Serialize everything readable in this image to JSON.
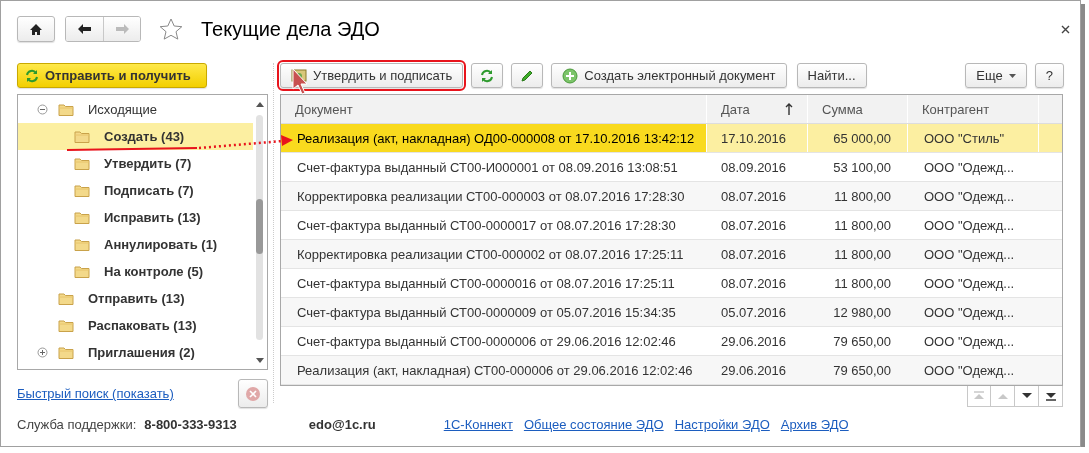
{
  "window": {
    "title": "Текущие дела ЭДО",
    "favorite": false
  },
  "nav": {
    "back_disabled": false,
    "forward_disabled": true
  },
  "left_panel": {
    "send_button": "Отправить и получить",
    "tree": [
      {
        "label": "Исходящие",
        "bold": false,
        "selected": false,
        "expanded": true,
        "children": [
          {
            "label": "Создать (43)",
            "bold": true,
            "selected": true
          },
          {
            "label": "Утвердить (7)",
            "bold": true,
            "selected": false
          },
          {
            "label": "Подписать (7)",
            "bold": true,
            "selected": false
          },
          {
            "label": "Исправить (13)",
            "bold": true,
            "selected": false
          },
          {
            "label": "Аннулировать (1)",
            "bold": true,
            "selected": false
          },
          {
            "label": "На контроле (5)",
            "bold": true,
            "selected": false
          }
        ]
      },
      {
        "label": "Отправить (13)",
        "bold": true,
        "selected": false
      },
      {
        "label": "Распаковать (13)",
        "bold": true,
        "selected": false
      },
      {
        "label": "Приглашения (2)",
        "bold": true,
        "selected": false,
        "expanded": false
      }
    ],
    "quick_search_link": "Быстрый поиск (показать)"
  },
  "toolbar": {
    "buttons": [
      {
        "kind": "approve",
        "label": "Утвердить и подписать",
        "highlighted": true
      },
      {
        "kind": "refresh"
      },
      {
        "kind": "edit"
      },
      {
        "kind": "create",
        "label": "Создать электронный документ"
      },
      {
        "kind": "text",
        "label": "Найти..."
      },
      {
        "kind": "menu",
        "label": "Еще"
      },
      {
        "kind": "text",
        "label": "?"
      }
    ]
  },
  "table": {
    "columns": [
      {
        "label": "Документ"
      },
      {
        "label": "Дата",
        "sort_ascending": true
      },
      {
        "label": "Сумма"
      },
      {
        "label": "Контрагент"
      }
    ],
    "rows": [
      {
        "document": "Реализация (акт, накладная) ОД00-000008 от 17.10.2016 13:42:12",
        "date": "17.10.2016",
        "sum": "65 000,00",
        "counterparty": "ООО \"Стиль\"",
        "selected": true
      },
      {
        "document": "Счет-фактура выданный СТ00-И000001 от 08.09.2016 13:08:51",
        "date": "08.09.2016",
        "sum": "53 100,00",
        "counterparty": "ООО \"Одежд...",
        "selected": false
      },
      {
        "document": "Корректировка реализации СТ00-000003 от 08.07.2016 17:28:30",
        "date": "08.07.2016",
        "sum": "11 800,00",
        "counterparty": "ООО \"Одежд...",
        "selected": false
      },
      {
        "document": "Счет-фактура выданный СТ00-0000017 от 08.07.2016 17:28:30",
        "date": "08.07.2016",
        "sum": "11 800,00",
        "counterparty": "ООО \"Одежд...",
        "selected": false
      },
      {
        "document": "Корректировка реализации СТ00-000002 от 08.07.2016 17:25:11",
        "date": "08.07.2016",
        "sum": "11 800,00",
        "counterparty": "ООО \"Одежд...",
        "selected": false
      },
      {
        "document": "Счет-фактура выданный СТ00-0000016 от 08.07.2016 17:25:11",
        "date": "08.07.2016",
        "sum": "11 800,00",
        "counterparty": "ООО \"Одежд...",
        "selected": false
      },
      {
        "document": "Счет-фактура выданный СТ00-0000009 от 05.07.2016 15:34:35",
        "date": "05.07.2016",
        "sum": "12 980,00",
        "counterparty": "ООО \"Одежд...",
        "selected": false
      },
      {
        "document": "Счет-фактура выданный СТ00-0000006 от 29.06.2016 12:02:46",
        "date": "29.06.2016",
        "sum": "79 650,00",
        "counterparty": "ООО \"Одежд...",
        "selected": false
      },
      {
        "document": "Реализация (акт, накладная) СТ00-000006 от 29.06.2016 12:02:46",
        "date": "29.06.2016",
        "sum": "79 650,00",
        "counterparty": "ООО \"Одежд...",
        "selected": false
      }
    ],
    "nav_buttons": [
      {
        "kind": "first",
        "disabled": true
      },
      {
        "kind": "up",
        "disabled": true
      },
      {
        "kind": "down",
        "disabled": false
      },
      {
        "kind": "last",
        "disabled": false
      }
    ]
  },
  "footer": {
    "support_label": "Служба поддержки:",
    "phone": "8-800-333-9313",
    "email": "edo@1c.ru",
    "links": [
      "1С-Коннект",
      "Общее состояние ЭДО",
      "Настройки ЭДО",
      "Архив ЭДО"
    ]
  }
}
